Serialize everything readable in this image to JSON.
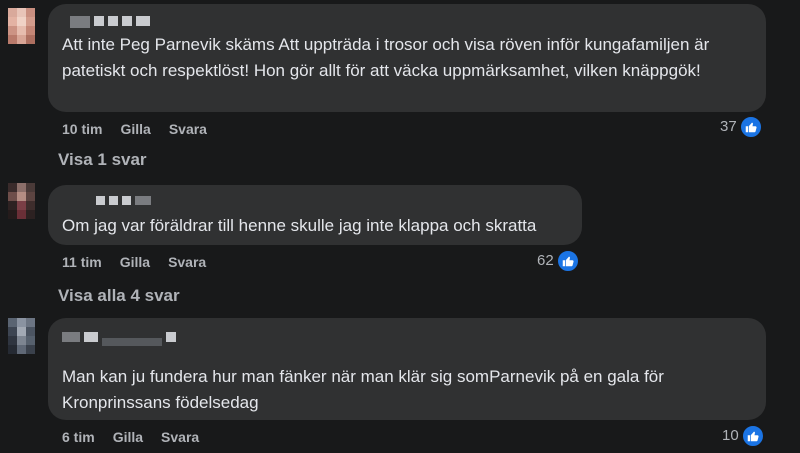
{
  "comments": [
    {
      "text": "Att inte Peg Parnevik skäms Att uppträda i trosor och visa röven inför kungafamiljen är patetiskt och respektlöst! Hon gör allt för att väcka uppmärksamhet, vilken knäppgök!",
      "time": "10 tim",
      "like_label": "Gilla",
      "reply_label": "Svara",
      "reaction_count": "37",
      "reaction_icon": "thumbs-up-icon",
      "replies_link": "Visa 1 svar"
    },
    {
      "text": "Om jag var föräldrar till henne skulle jag inte klappa och skratta",
      "time": "11 tim",
      "like_label": "Gilla",
      "reply_label": "Svara",
      "reaction_count": "62",
      "reaction_icon": "thumbs-up-icon",
      "replies_link": "Visa alla 4 svar"
    },
    {
      "text": "Man kan ju fundera hur man fänker när man klär sig somParnevik på en gala för Kronprinssans födelsedag",
      "time": "6 tim",
      "like_label": "Gilla",
      "reply_label": "Svara",
      "reaction_count": "10",
      "reaction_icon": "thumbs-up-icon"
    }
  ],
  "colors": {
    "background": "#18191a",
    "bubble": "#303132",
    "text": "#e4e6eb",
    "secondary_text": "#b0b3b8",
    "like_blue": "#1b74e4"
  }
}
